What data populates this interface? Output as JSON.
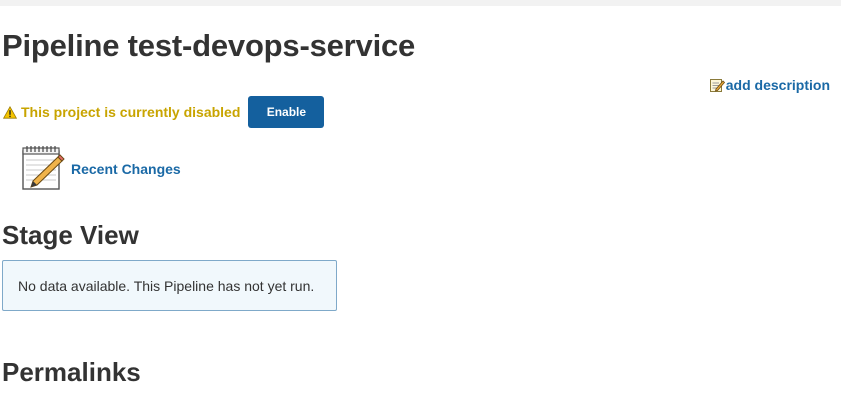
{
  "page": {
    "title": "Pipeline test-devops-service"
  },
  "description": {
    "add_label": "add description",
    "icon": "edit-note-icon"
  },
  "status": {
    "icon": "warning-icon",
    "message": "This project is currently disabled",
    "enable_label": "Enable"
  },
  "recent_changes": {
    "icon": "notepad-pencil-icon",
    "label": "Recent Changes"
  },
  "stage_view": {
    "title": "Stage View",
    "empty_message": "No data available. This Pipeline has not yet run."
  },
  "permalinks": {
    "title": "Permalinks"
  },
  "colors": {
    "link": "#1a69a6",
    "warning_text": "#c8a400",
    "button_bg": "#14609e",
    "info_box_bg": "#f1f8fc",
    "info_box_border": "#7fa9c9"
  }
}
